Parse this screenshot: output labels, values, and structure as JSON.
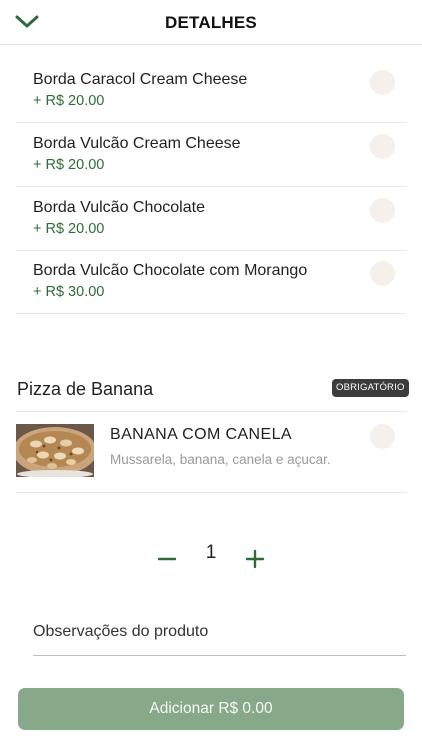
{
  "header": {
    "title": "DETALHES",
    "back_icon": "chevron-down-icon"
  },
  "options": [
    {
      "name": "Borda Caracol Cream Cheese",
      "price": "+ R$ 20.00"
    },
    {
      "name": "Borda Vulcão Cream Cheese",
      "price": "+ R$ 20.00"
    },
    {
      "name": "Borda Vulcão Chocolate",
      "price": "+ R$ 20.00"
    },
    {
      "name": "Borda Vulcão Chocolate com Morango",
      "price": "+ R$ 30.00"
    }
  ],
  "pizza_section": {
    "title": "Pizza de Banana",
    "badge": "OBRIGATÓRIO",
    "item": {
      "name": "BANANA COM CANELA",
      "description": "Mussarela, banana, canela e açucar."
    }
  },
  "quantity": {
    "value": "1"
  },
  "notes": {
    "label": "Observações do produto"
  },
  "add_button": {
    "label": "Adicionar R$ 0.00"
  },
  "colors": {
    "accent_green": "#2f6b3a",
    "button_green": "#87a98a",
    "radio_fill": "#f5f0ec",
    "badge_bg": "#3c3c3c"
  }
}
